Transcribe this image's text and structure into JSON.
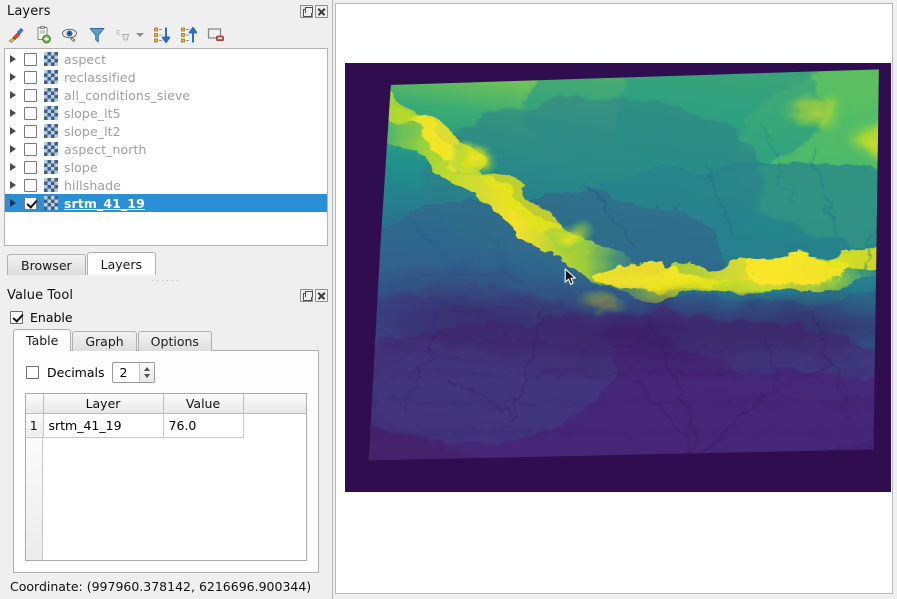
{
  "layers_panel": {
    "title": "Layers",
    "window_buttons": [
      {
        "name": "float-button",
        "label": "Float"
      },
      {
        "name": "close-button",
        "label": "Close"
      }
    ],
    "toolbar": [
      {
        "name": "open-layer-styling-panel-icon",
        "label": "Open the Layer Styling panel"
      },
      {
        "name": "add-group-icon",
        "label": "Add Group"
      },
      {
        "name": "manage-map-themes-icon",
        "label": "Manage Map Themes"
      },
      {
        "name": "filter-legend-icon",
        "label": "Filter Legend"
      },
      {
        "name": "filter-legend-by-expression-icon",
        "label": "Filter Legend by Expression"
      },
      {
        "name": "expand-all-icon",
        "label": "Expand All"
      },
      {
        "name": "collapse-all-icon",
        "label": "Collapse All"
      },
      {
        "name": "remove-layer-icon",
        "label": "Remove Layer/Group"
      }
    ],
    "layers": [
      {
        "name": "aspect",
        "checked": false,
        "selected": false
      },
      {
        "name": "reclassified",
        "checked": false,
        "selected": false
      },
      {
        "name": "all_conditions_sieve",
        "checked": false,
        "selected": false
      },
      {
        "name": "slope_lt5",
        "checked": false,
        "selected": false
      },
      {
        "name": "slope_lt2",
        "checked": false,
        "selected": false
      },
      {
        "name": "aspect_north",
        "checked": false,
        "selected": false
      },
      {
        "name": "slope",
        "checked": false,
        "selected": false
      },
      {
        "name": "hillshade",
        "checked": false,
        "selected": false
      },
      {
        "name": "srtm_41_19",
        "checked": true,
        "selected": true
      }
    ]
  },
  "dock_tabs": [
    {
      "label": "Browser",
      "active": false
    },
    {
      "label": "Layers",
      "active": true
    }
  ],
  "value_tool": {
    "title": "Value Tool",
    "window_buttons": [
      {
        "name": "float-button",
        "label": "Float"
      },
      {
        "name": "close-button",
        "label": "Close"
      }
    ],
    "enable": {
      "label": "Enable",
      "checked": true
    },
    "tabs": [
      {
        "label": "Table",
        "active": true
      },
      {
        "label": "Graph",
        "active": false
      },
      {
        "label": "Options",
        "active": false
      }
    ],
    "decimals": {
      "label": "Decimals",
      "checked": false,
      "value": "2"
    },
    "table": {
      "headers": [
        "Layer",
        "Value"
      ],
      "rows": [
        {
          "index": "1",
          "layer": "srtm_41_19",
          "value": "76.0"
        }
      ]
    }
  },
  "status": {
    "coordinate": "Coordinate: (997960.378142, 6216696.900344)"
  },
  "map": {
    "cursor": "arrow-cursor",
    "layer_rendered": "srtm_41_19",
    "colormap": "viridis"
  },
  "colors": {
    "selection_blue": "#2a8fd4",
    "panel_bg": "#efefef",
    "canvas_bg": "#ffffff",
    "disabled_text": "#9e9e9e",
    "raster_nodata": "#300d4f"
  }
}
